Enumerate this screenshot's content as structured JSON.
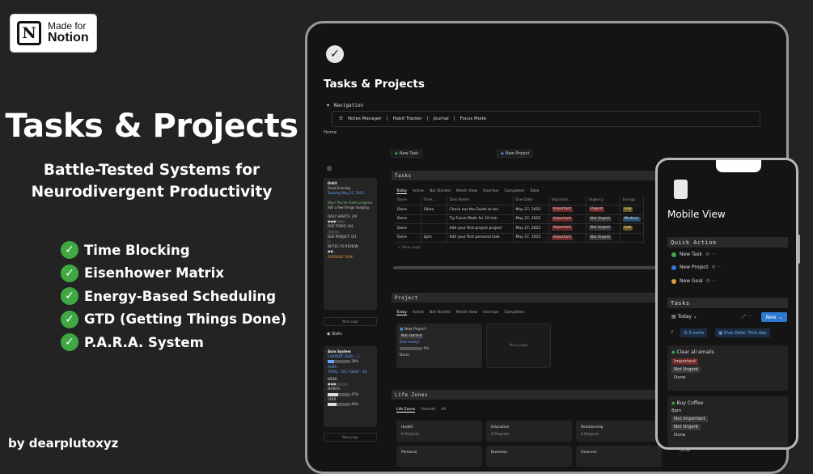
{
  "badge": {
    "line1": "Made for",
    "line2": "Notion",
    "logo_letter": "N"
  },
  "hero": {
    "title": "Tasks & Projects",
    "subtitle_line1": "Battle-Tested Systems for",
    "subtitle_line2": "Neurodivergent Productivity",
    "features": [
      "Time Blocking",
      "Eisenhower Matrix",
      "Energy-Based Scheduling",
      "GTD (Getting Things Done)",
      "P.A.R.A. System"
    ],
    "byline": "by dearplutoxyz"
  },
  "colors": {
    "check_green": "#3fa843",
    "new_button_blue": "#2f7ad1",
    "urgent_red": "#6b2a2a"
  },
  "laptop": {
    "page_title": "Tasks & Projects",
    "navigation_label": "Navigation",
    "nav_links": [
      "Notes Manager",
      "Habit Tracker",
      "Journal",
      "Focus Mode"
    ],
    "home_label": "Home",
    "new_task_button": "New Task",
    "new_project_button": "New Project",
    "orbit_card": {
      "title": "Orbit",
      "greeting": "Good Evening",
      "date": "Tuesday May 27, 2025",
      "progress_note": "Woo! You've made progress",
      "hanging": "Still a few things hanging.",
      "daily_habits": "DAILY HABITS: 3/9",
      "due_tasks": "DUE TASKS: 0/4",
      "due_project": "DUE PROJECT: 0/1",
      "notes_review": "NOTES TO REVIEW:",
      "overdue": "OVERDUE TASK:"
    },
    "new_page_label": "New page",
    "stats_label": "Stats",
    "aura_card": {
      "title": "Aura System",
      "current_level": "CURRENT LEVEL : 1",
      "level_pct": "28%",
      "aura_label": "AURA :",
      "aura_total": "TOTAL : 28  |  TODAY : 28",
      "week": "WEEK",
      "month": "MONTH",
      "month_pct": "47%",
      "year": "YEAR",
      "year_pct": "40%"
    },
    "tasks_section": {
      "header": "Tasks",
      "tabs": [
        "Today",
        "Active",
        "Not Started",
        "Month View",
        "Overdue",
        "Completed",
        "Table"
      ],
      "columns": [
        "Done",
        "Time...",
        "Task Name",
        "Due Date",
        "Importan...",
        "Urgency",
        "Energy"
      ],
      "rows": [
        {
          "done": "Done",
          "time": "10am",
          "name": "Check out the Guide to bei",
          "due": "May 27, 2025",
          "importance": "Important",
          "urgency": "Urgent",
          "energy": "Low"
        },
        {
          "done": "Done",
          "time": "",
          "name": "Try Focus Mode for 10 min",
          "due": "May 27, 2025",
          "importance": "Important",
          "urgency": "Not Urgent",
          "energy": "Medium"
        },
        {
          "done": "Done",
          "time": "",
          "name": "Add your first project project",
          "due": "May 27, 2025",
          "importance": "Important",
          "urgency": "Not Urgent",
          "energy": "Low"
        },
        {
          "done": "Done",
          "time": "2pm",
          "name": "Add your first personal task",
          "due": "May 27, 2025",
          "importance": "Important",
          "urgency": "Not Urgent",
          "energy": ""
        }
      ],
      "new_page": "New page"
    },
    "project_section": {
      "header": "Project",
      "tabs": [
        "Today",
        "Active",
        "Not Started",
        "Month View",
        "Overdue",
        "Completed"
      ],
      "card_title": "New Project",
      "card_status": "Not started",
      "card_due": "Due today!",
      "card_progress": "0%",
      "card_done": "Done",
      "new_page": "New page"
    },
    "life_zones": {
      "header": "Life Zones",
      "tabs": [
        "Life Zones",
        "Favorite",
        "All"
      ],
      "zones": [
        {
          "name": "Health",
          "sub": "0 Projects"
        },
        {
          "name": "Education",
          "sub": "0 Projects"
        },
        {
          "name": "Relationship",
          "sub": "0 Projects"
        },
        {
          "name": "Personal",
          "sub": ""
        },
        {
          "name": "Business",
          "sub": ""
        },
        {
          "name": "Finances",
          "sub": ""
        }
      ]
    }
  },
  "phone": {
    "title": "Mobile View",
    "quick_action_header": "Quick Action",
    "quick_actions": [
      "New Task",
      "New Project",
      "New Goal"
    ],
    "tasks_header": "Tasks",
    "view_label": "Today",
    "new_button": "New",
    "sorts_label": "3 sorts",
    "filter_label": "Due Date: This day",
    "cards": [
      {
        "title": "Clear all emails",
        "tags": [
          "Important",
          "Not Urgent",
          "Done"
        ]
      },
      {
        "title": "Buy Coffee",
        "time": "8pm",
        "tags": [
          "Not Important",
          "Not Urgent",
          "Done"
        ]
      }
    ],
    "partial_item": "Other"
  }
}
